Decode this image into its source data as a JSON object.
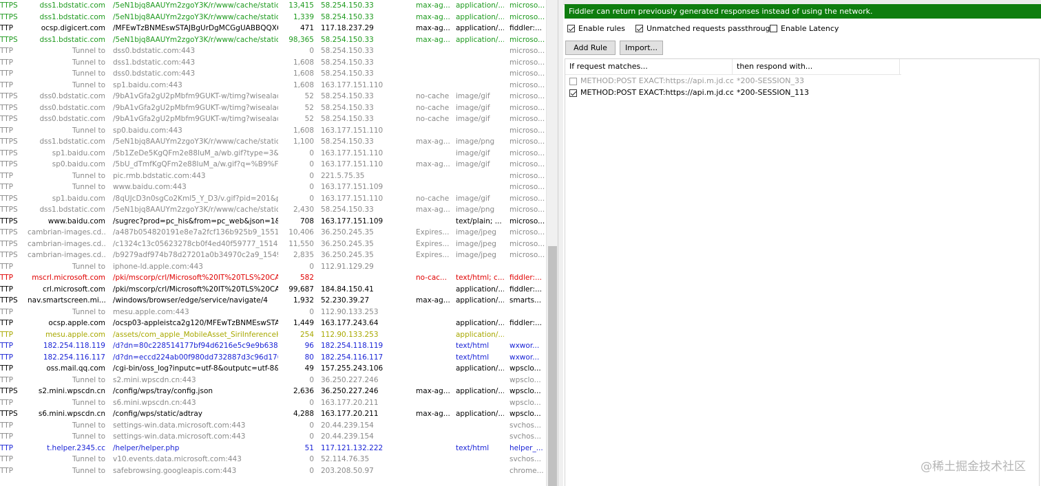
{
  "sessions": [
    {
      "proto": "TTPS",
      "host": "dss1.bdstatic.com",
      "url": "/5eN1bjq8AAUYm2zgoY3K/r/www/cache/static/p...",
      "body": "13,415",
      "ip": "58.254.150.33",
      "cache": "max-ag...",
      "ctype": "application/...",
      "proc": "microso...",
      "color": "green"
    },
    {
      "proto": "TTPS",
      "host": "dss1.bdstatic.com",
      "url": "/5eN1bjq8AAUYm2zgoY3K/r/www/cache/static/p...",
      "body": "1,339",
      "ip": "58.254.150.33",
      "cache": "max-ag...",
      "ctype": "application/...",
      "proc": "microso...",
      "color": "green"
    },
    {
      "proto": "TTP",
      "host": "ocsp.digicert.com",
      "url": "/MFEwTzBNMEswSTAJBgUrDgMCGgUABBQQX6Z...",
      "body": "471",
      "ip": "117.18.237.29",
      "cache": "max-ag...",
      "ctype": "application/...",
      "proc": "fiddler:...",
      "color": "black"
    },
    {
      "proto": "TTPS",
      "host": "dss1.bdstatic.com",
      "url": "/5eN1bjq8AAUYm2zgoY3K/r/www/cache/static/p...",
      "body": "98,365",
      "ip": "58.254.150.33",
      "cache": "max-ag...",
      "ctype": "application/...",
      "proc": "microso...",
      "color": "green"
    },
    {
      "proto": "TTP",
      "host": "Tunnel to",
      "url": "dss0.bdstatic.com:443",
      "body": "0",
      "ip": "58.254.150.33",
      "cache": "",
      "ctype": "",
      "proc": "microso...",
      "color": "gray"
    },
    {
      "proto": "TTP",
      "host": "Tunnel to",
      "url": "dss1.bdstatic.com:443",
      "body": "1,608",
      "ip": "58.254.150.33",
      "cache": "",
      "ctype": "",
      "proc": "microso...",
      "color": "gray"
    },
    {
      "proto": "TTP",
      "host": "Tunnel to",
      "url": "dss0.bdstatic.com:443",
      "body": "1,608",
      "ip": "58.254.150.33",
      "cache": "",
      "ctype": "",
      "proc": "microso...",
      "color": "gray"
    },
    {
      "proto": "TTP",
      "host": "Tunnel to",
      "url": "sp1.baidu.com:443",
      "body": "1,608",
      "ip": "163.177.151.110",
      "cache": "",
      "ctype": "",
      "proc": "microso...",
      "color": "gray"
    },
    {
      "proto": "TTPS",
      "host": "dss0.bdstatic.com",
      "url": "/9bA1vGfa2gU2pMbfm9GUKT-w/timg?wisealaddi...",
      "body": "52",
      "ip": "58.254.150.33",
      "cache": "no-cache",
      "ctype": "image/gif",
      "proc": "microso...",
      "color": "gray"
    },
    {
      "proto": "TTPS",
      "host": "dss0.bdstatic.com",
      "url": "/9bA1vGfa2gU2pMbfm9GUKT-w/timg?wisealaddi...",
      "body": "52",
      "ip": "58.254.150.33",
      "cache": "no-cache",
      "ctype": "image/gif",
      "proc": "microso...",
      "color": "gray"
    },
    {
      "proto": "TTPS",
      "host": "dss0.bdstatic.com",
      "url": "/9bA1vGfa2gU2pMbfm9GUKT-w/timg?wisealaddi...",
      "body": "52",
      "ip": "58.254.150.33",
      "cache": "no-cache",
      "ctype": "image/gif",
      "proc": "microso...",
      "color": "gray"
    },
    {
      "proto": "TTP",
      "host": "Tunnel to",
      "url": "sp0.baidu.com:443",
      "body": "1,608",
      "ip": "163.177.151.110",
      "cache": "",
      "ctype": "",
      "proc": "microso...",
      "color": "gray"
    },
    {
      "proto": "TTPS",
      "host": "dss1.bdstatic.com",
      "url": "/5eN1bjq8AAUYm2zgoY3K/r/www/cache/static/p...",
      "body": "1,100",
      "ip": "58.254.150.33",
      "cache": "max-ag...",
      "ctype": "image/png",
      "proc": "microso...",
      "color": "gray"
    },
    {
      "proto": "TTPS",
      "host": "sp1.baidu.com",
      "url": "/5b1ZeDe5KgQFm2e88IuM_a/wb.gif?type=3&fm...",
      "body": "0",
      "ip": "163.177.151.110",
      "cache": "",
      "ctype": "image/gif",
      "proc": "microso...",
      "color": "gray"
    },
    {
      "proto": "TTPS",
      "host": "sp0.baidu.com",
      "url": "/5bU_dTmfKgQFm2e88IuM_a/w.gif?q=%B9%FA...",
      "body": "0",
      "ip": "163.177.151.110",
      "cache": "max-ag...",
      "ctype": "image/gif",
      "proc": "microso...",
      "color": "gray"
    },
    {
      "proto": "TTP",
      "host": "Tunnel to",
      "url": "pic.rmb.bdstatic.com:443",
      "body": "0",
      "ip": "221.5.75.35",
      "cache": "",
      "ctype": "",
      "proc": "microso...",
      "color": "gray"
    },
    {
      "proto": "TTP",
      "host": "Tunnel to",
      "url": "www.baidu.com:443",
      "body": "0",
      "ip": "163.177.151.109",
      "cache": "",
      "ctype": "",
      "proc": "microso...",
      "color": "gray"
    },
    {
      "proto": "TTPS",
      "host": "sp1.baidu.com",
      "url": "/8qUJcD3n0sgCo2Kml5_Y_D3/v.gif?pid=201&pj=...",
      "body": "0",
      "ip": "163.177.151.110",
      "cache": "no-cache",
      "ctype": "image/gif",
      "proc": "microso...",
      "color": "gray"
    },
    {
      "proto": "TTPS",
      "host": "dss1.bdstatic.com",
      "url": "/5eN1bjq8AAUYm2zgoY3K/r/www/cache/static/p...",
      "body": "2,430",
      "ip": "58.254.150.33",
      "cache": "max-ag...",
      "ctype": "image/png",
      "proc": "microso...",
      "color": "gray"
    },
    {
      "proto": "TTPS",
      "host": "www.baidu.com",
      "url": "/sugrec?prod=pc_his&from=pc_web&json=1&sid...",
      "body": "708",
      "ip": "163.177.151.109",
      "cache": "",
      "ctype": "text/plain; ...",
      "proc": "microso...",
      "color": "black"
    },
    {
      "proto": "TTPS",
      "host": "cambrian-images.cd...",
      "url": "/a487b054820191e8e7a2fcf136b925b9_155132...",
      "body": "10,406",
      "ip": "36.250.245.35",
      "cache": "Expires...",
      "ctype": "image/jpeg",
      "proc": "microso...",
      "color": "gray"
    },
    {
      "proto": "TTPS",
      "host": "cambrian-images.cd...",
      "url": "/c1324c13c05623278cb0f4ed40f59777_1514960...",
      "body": "11,550",
      "ip": "36.250.245.35",
      "cache": "Expires...",
      "ctype": "image/jpeg",
      "proc": "microso...",
      "color": "gray"
    },
    {
      "proto": "TTPS",
      "host": "cambrian-images.cd...",
      "url": "/b9279adf974b78d27201a0b34970c2a9_154994...",
      "body": "2,835",
      "ip": "36.250.245.35",
      "cache": "Expires...",
      "ctype": "image/jpeg",
      "proc": "microso...",
      "color": "gray"
    },
    {
      "proto": "TTP",
      "host": "Tunnel to",
      "url": "iphone-ld.apple.com:443",
      "body": "0",
      "ip": "112.91.129.29",
      "cache": "",
      "ctype": "",
      "proc": "",
      "color": "gray"
    },
    {
      "proto": "TTP",
      "host": "mscrl.microsoft.com",
      "url": "/pki/mscorp/crl/Microsoft%20IT%20TLS%20CA...",
      "body": "582",
      "ip": "",
      "cache": "no-cac...",
      "ctype": "text/html; c...",
      "proc": "fiddler:...",
      "color": "red"
    },
    {
      "proto": "TTP",
      "host": "crl.microsoft.com",
      "url": "/pki/mscorp/crl/Microsoft%20IT%20TLS%20CA...",
      "body": "99,687",
      "ip": "184.84.150.41",
      "cache": "",
      "ctype": "application/...",
      "proc": "fiddler:...",
      "color": "black"
    },
    {
      "proto": "TTPS",
      "host": "nav.smartscreen.mi...",
      "url": "/windows/browser/edge/service/navigate/4",
      "body": "1,932",
      "ip": "52.230.39.27",
      "cache": "max-ag...",
      "ctype": "application/...",
      "proc": "smarts...",
      "color": "black"
    },
    {
      "proto": "TTP",
      "host": "Tunnel to",
      "url": "mesu.apple.com:443",
      "body": "0",
      "ip": "112.90.133.253",
      "cache": "",
      "ctype": "",
      "proc": "",
      "color": "gray"
    },
    {
      "proto": "TTP",
      "host": "ocsp.apple.com",
      "url": "/ocsp03-appleistca2g120/MFEwTzBNMEswSTAJB...",
      "body": "1,449",
      "ip": "163.177.243.64",
      "cache": "",
      "ctype": "application/...",
      "proc": "fiddler:...",
      "color": "black"
    },
    {
      "proto": "TTP",
      "host": "mesu.apple.com",
      "url": "/assets/com_apple_MobileAsset_SiriInferenceHol...",
      "body": "254",
      "ip": "112.90.133.253",
      "cache": "",
      "ctype": "application/...",
      "proc": "",
      "color": "olive"
    },
    {
      "proto": "TTP",
      "host": "182.254.118.119",
      "url": "/d?dn=80c228514177bf94d6216e5c9e9b638d5c...",
      "body": "96",
      "ip": "182.254.118.119",
      "cache": "",
      "ctype": "text/html",
      "proc": "wxwor...",
      "color": "blue"
    },
    {
      "proto": "TTP",
      "host": "182.254.116.117",
      "url": "/d?dn=eccd224ab00f980dd732887d3c96d170&i...",
      "body": "80",
      "ip": "182.254.116.117",
      "cache": "",
      "ctype": "text/html",
      "proc": "wxwor...",
      "color": "blue"
    },
    {
      "proto": "TTP",
      "host": "oss.mail.qq.com",
      "url": "/cgi-bin/oss_log?inputc=utf-8&outputc=utf-8&fu...",
      "body": "49",
      "ip": "157.255.243.106",
      "cache": "",
      "ctype": "application/...",
      "proc": "wpsclo...",
      "color": "black"
    },
    {
      "proto": "TTP",
      "host": "Tunnel to",
      "url": "s2.mini.wpscdn.cn:443",
      "body": "0",
      "ip": "36.250.227.246",
      "cache": "",
      "ctype": "",
      "proc": "wpsclo...",
      "color": "gray"
    },
    {
      "proto": "TTPS",
      "host": "s2.mini.wpscdn.cn",
      "url": "/config/wps/tray/config.json",
      "body": "2,636",
      "ip": "36.250.227.246",
      "cache": "max-ag...",
      "ctype": "application/...",
      "proc": "wpsclo...",
      "color": "black"
    },
    {
      "proto": "TTP",
      "host": "Tunnel to",
      "url": "s6.mini.wpscdn.cn:443",
      "body": "0",
      "ip": "163.177.20.211",
      "cache": "",
      "ctype": "",
      "proc": "wpsclo...",
      "color": "gray"
    },
    {
      "proto": "TTPS",
      "host": "s6.mini.wpscdn.cn",
      "url": "/config/wps/static/adtray",
      "body": "4,288",
      "ip": "163.177.20.211",
      "cache": "max-ag...",
      "ctype": "application/...",
      "proc": "wpsclo...",
      "color": "black"
    },
    {
      "proto": "TTP",
      "host": "Tunnel to",
      "url": "settings-win.data.microsoft.com:443",
      "body": "0",
      "ip": "20.44.239.154",
      "cache": "",
      "ctype": "",
      "proc": "svchos...",
      "color": "gray"
    },
    {
      "proto": "TTP",
      "host": "Tunnel to",
      "url": "settings-win.data.microsoft.com:443",
      "body": "0",
      "ip": "20.44.239.154",
      "cache": "",
      "ctype": "",
      "proc": "svchos...",
      "color": "gray"
    },
    {
      "proto": "TTP",
      "host": "t.helper.2345.cc",
      "url": "/helper/helper.php",
      "body": "51",
      "ip": "117.121.132.222",
      "cache": "",
      "ctype": "text/html",
      "proc": "helper_...",
      "color": "blue"
    },
    {
      "proto": "TTP",
      "host": "Tunnel to",
      "url": "v10.events.data.microsoft.com:443",
      "body": "0",
      "ip": "52.114.76.35",
      "cache": "",
      "ctype": "",
      "proc": "svchos...",
      "color": "gray"
    },
    {
      "proto": "TTP",
      "host": "Tunnel to",
      "url": "safebrowsing.googleapis.com:443",
      "body": "0",
      "ip": "203.208.50.97",
      "cache": "",
      "ctype": "",
      "proc": "chrome...",
      "color": "gray"
    }
  ],
  "autoresponder": {
    "banner": "Fiddler can return previously generated responses instead of using the network.",
    "options": [
      {
        "label": "Enable rules",
        "checked": true
      },
      {
        "label": "Unmatched requests passthrough",
        "checked": true
      },
      {
        "label": "Enable Latency",
        "checked": false
      }
    ],
    "add_rule_label": "Add Rule",
    "import_label": "Import...",
    "col_match": "If request matches...",
    "col_respond": "then respond with...",
    "rules": [
      {
        "match": "METHOD:POST EXACT:https://api.m.jd.com/...",
        "respond": "*200-SESSION_33",
        "checked": false
      },
      {
        "match": "METHOD:POST EXACT:https://api.m.jd.com/...",
        "respond": "*200-SESSION_113",
        "checked": true
      }
    ]
  },
  "watermark": "@稀土掘金技术社区"
}
